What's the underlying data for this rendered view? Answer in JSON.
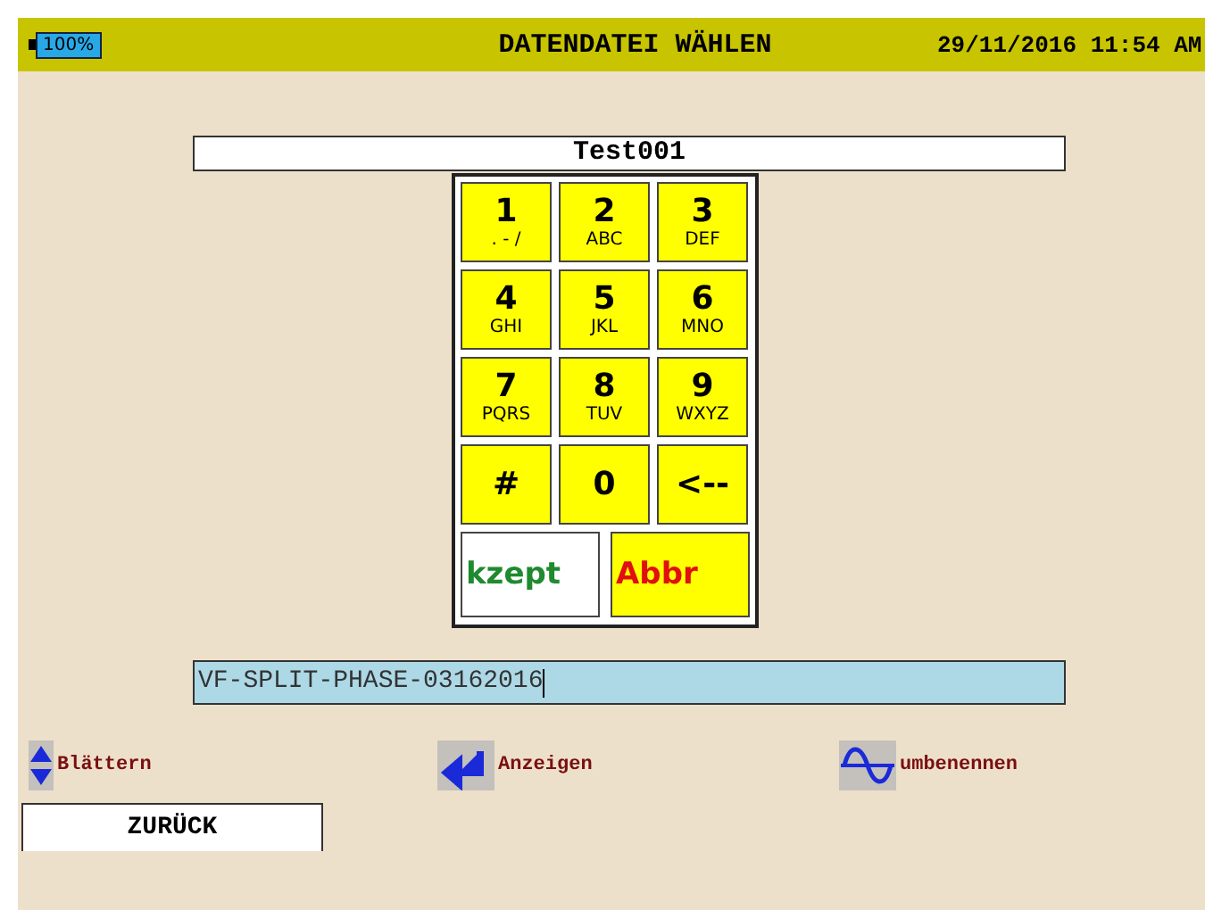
{
  "header": {
    "battery": "100%",
    "title": "DATENDATEI WÄHLEN",
    "datetime": "29/11/2016 11:54 AM"
  },
  "name_field": {
    "value": "Test001"
  },
  "keypad": {
    "keys": [
      {
        "main": "1",
        "sub": ". - /"
      },
      {
        "main": "2",
        "sub": "ABC"
      },
      {
        "main": "3",
        "sub": "DEF"
      },
      {
        "main": "4",
        "sub": "GHI"
      },
      {
        "main": "5",
        "sub": "JKL"
      },
      {
        "main": "6",
        "sub": "MNO"
      },
      {
        "main": "7",
        "sub": "PQRS"
      },
      {
        "main": "8",
        "sub": "TUV"
      },
      {
        "main": "9",
        "sub": "WXYZ"
      },
      {
        "main": "#"
      },
      {
        "main": "0"
      },
      {
        "main": "<--"
      }
    ],
    "actions": [
      {
        "label": "kzept",
        "kind": "accept"
      },
      {
        "label": "Abbr",
        "kind": "cancel"
      }
    ]
  },
  "file_field": {
    "value": "VF-SPLIT-PHASE-03162016"
  },
  "softkeys": [
    {
      "label": "Blättern",
      "kind": "updown"
    },
    {
      "label": "Anzeigen",
      "kind": "enter"
    },
    {
      "label": "umbenennen",
      "kind": "wave"
    }
  ],
  "back_button": {
    "label": "ZURÜCK"
  }
}
